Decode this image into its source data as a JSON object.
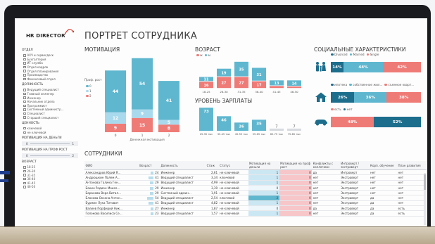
{
  "app": {
    "logo_main": "HR DIRECTOR",
    "title": "ПОРТРЕТ СОТРУДНИКА"
  },
  "sidebar": {
    "groups": [
      {
        "title": "Отдел",
        "items": [
          "АХЧ и сервисдеск",
          "Бухгалтерия",
          "ИТ служба",
          "Отдел кадров",
          "Отдел планирования",
          "Производство",
          "Финансовый отдел"
        ]
      },
      {
        "title": "Должность",
        "items": [
          "Ведущий специалист",
          "Главный инженер",
          "Инженер",
          "Начальник отдела",
          "Программист",
          "Системный администр...",
          "Специалист",
          "Старший специалист"
        ]
      },
      {
        "title": "Ценность",
        "items": [
          "ключевой",
          "не ключевой"
        ]
      }
    ],
    "slicers": [
      {
        "title": "Мотивация на деньги",
        "min": "0",
        "max": "1"
      },
      {
        "title": "Мотивация на проф рост",
        "min": "0",
        "max": "2"
      }
    ],
    "age_group": {
      "title": "Возраст",
      "items": [
        "18-25",
        "26-30",
        "31-35",
        "36-40",
        "41-45",
        "46-50"
      ]
    }
  },
  "motivation": {
    "title": "МОТИВАЦИЯ",
    "axis_legend_title": "Проф. рост",
    "legend": [
      "0",
      "1",
      "2"
    ],
    "xlabel": "Денежная мотивация"
  },
  "age": {
    "title": "ВОЗРАСТ",
    "legend": [
      "ж",
      "м"
    ]
  },
  "salary": {
    "title": "УРОВЕНЬ ЗАРПЛАТЫ"
  },
  "social": {
    "title": "СОЦИАЛЬНЫЕ ХАРАКТЕРИСТИКИ",
    "row1_legend": [
      "Divorced",
      "Married",
      "Single"
    ],
    "row1": [
      {
        "label": "14%",
        "value": 14
      },
      {
        "label": "44%",
        "value": 44
      },
      {
        "label": "42%",
        "value": 42
      }
    ],
    "row2_legend": [
      "ипотека",
      "собственное жил...",
      "съемное кварт..."
    ],
    "row2": [
      {
        "label": "26%",
        "value": 26
      },
      {
        "label": "36%",
        "value": 36
      },
      {
        "label": "38%",
        "value": 38
      }
    ],
    "row3_legend": [
      "есть",
      "нет"
    ],
    "row3": [
      {
        "label": "48%",
        "value": 48
      },
      {
        "label": "52%",
        "value": 52
      }
    ],
    "icons": [
      "family-icon",
      "house-icon",
      "car-icon"
    ]
  },
  "employees": {
    "title": "СОТРУДНИКИ",
    "columns": [
      "ФИО",
      "Возраст",
      "Должность",
      "Стаж",
      "Статус",
      "Мотивация на деньги",
      "Мотивация на проф рост",
      "Конфликты с коллегами",
      "Интроверт / экстраверт",
      "Корп. обучение",
      "План развития"
    ],
    "rows": [
      {
        "name": "Александров Юрий Я...",
        "age": "24",
        "position": "Инженер",
        "exp": "2,61",
        "status": "не ключевой",
        "money": "1",
        "growth": "0",
        "conflicts": "да",
        "type": "Интроверт",
        "training": "нет",
        "plan": "нет"
      },
      {
        "name": "Андрюшкин Палем А...",
        "age": "41",
        "position": "Ведущий специалист",
        "exp": "3,34",
        "status": "ключевой",
        "money": "1",
        "growth": "0",
        "conflicts": "нет",
        "type": "Экстраверт",
        "training": "нет",
        "plan": "нет"
      },
      {
        "name": "Антонова Галина Ген...",
        "age": "29",
        "position": "Ведущий специалист",
        "exp": "4,99",
        "status": "не ключевой",
        "money": "1",
        "growth": "0",
        "conflicts": "нет",
        "type": "Экстраверт",
        "training": "нет",
        "plan": "нет"
      },
      {
        "name": "Бакин Родион Моисе...",
        "age": "29",
        "position": "Инженер",
        "exp": "3,39",
        "status": "не ключевой",
        "money": "0",
        "growth": "0",
        "conflicts": "нет",
        "type": "Экстраверт",
        "training": "нет",
        "plan": "нет"
      },
      {
        "name": "Баранова Вера Витал...",
        "age": "29",
        "position": "Системный админ...",
        "exp": "1,91",
        "status": "не ключевой",
        "money": "1",
        "growth": "0",
        "conflicts": "нет",
        "type": "Экстраверт",
        "training": "нет",
        "plan": "нет"
      },
      {
        "name": "Блохова Оксана Антон...",
        "age": "54",
        "position": "Ведущий специалист",
        "exp": "2,54",
        "status": "ключевой",
        "money": "2",
        "growth": "0",
        "conflicts": "нет",
        "type": "Экстраверт",
        "training": "да",
        "plan": "нет"
      },
      {
        "name": "Бурмин Лука Титович",
        "age": "41",
        "position": "Ведущий специалист",
        "exp": "4,82",
        "status": "не ключевой",
        "money": "1",
        "growth": "0",
        "conflicts": "нет",
        "type": "Экстраверт",
        "training": "да",
        "plan": "нет"
      },
      {
        "name": "Валиев Порфирий Ник...",
        "age": "27",
        "position": "Инженер",
        "exp": "1,87",
        "status": "не ключевой",
        "money": "0",
        "growth": "0",
        "conflicts": "да",
        "type": "Экстраверт",
        "training": "да",
        "plan": "есть"
      },
      {
        "name": "Голокова Василиса Се...",
        "age": "23",
        "position": "Ведущий специалист",
        "exp": "1,57",
        "status": "не ключевой",
        "money": "1",
        "growth": "0",
        "conflicts": "нет",
        "type": "Экстраверт",
        "training": "да",
        "plan": "есть"
      }
    ]
  },
  "colors": {
    "teal": "#5fb7cf",
    "light_blue": "#a9d9ec",
    "salmon": "#ef7b77",
    "dark_teal": "#1d6d8c",
    "navy": "#1f3d8f"
  },
  "chart_data": [
    {
      "type": "bar",
      "title": "МОТИВАЦИЯ",
      "categories": [
        "0",
        "1",
        "2"
      ],
      "xlabel": "Денежная мотивация",
      "legend_title": "Проф. рост",
      "stacked": true,
      "series": [
        {
          "name": "0",
          "values": [
            44,
            54,
            41
          ]
        },
        {
          "name": "1",
          "values": [
            12,
            9,
            5
          ]
        },
        {
          "name": "2",
          "values": [
            9,
            15,
            8
          ]
        }
      ]
    },
    {
      "type": "bar",
      "title": "ВОЗРАСТ",
      "categories": [
        "18-25",
        "26-30",
        "31-35",
        "36-40",
        "41-45",
        "46-50"
      ],
      "stacked": true,
      "series": [
        {
          "name": "м",
          "values": [
            11,
            19,
            35,
            31,
            13,
            14
          ]
        },
        {
          "name": "ж",
          "values": [
            16,
            27,
            27,
            17,
            6,
            5
          ]
        }
      ]
    },
    {
      "type": "bar",
      "title": "УРОВЕНЬ ЗАРПЛАТЫ",
      "categories": [
        "25-35 тыс",
        "35-45 тыс",
        "45-55 тыс",
        "55-65 тыс",
        "65-75 тыс",
        "75-85 тыс"
      ],
      "values": [
        73,
        46,
        26,
        35,
        7,
        7
      ]
    }
  ]
}
